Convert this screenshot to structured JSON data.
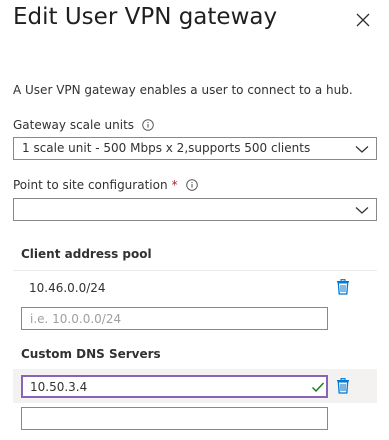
{
  "panel": {
    "title": "Edit User VPN gateway",
    "description": "A User VPN gateway enables a user to connect to a hub."
  },
  "gateway_scale_units": {
    "label": "Gateway scale units",
    "selected": "1 scale unit - 500 Mbps x 2,supports 500 clients"
  },
  "point_to_site": {
    "label": "Point to site configuration",
    "required_marker": "*",
    "selected": ""
  },
  "client_address_pool": {
    "heading": "Client address pool",
    "entries": [
      "10.46.0.0/24"
    ],
    "new_entry_placeholder": "i.e. 10.0.0.0/24"
  },
  "custom_dns_servers": {
    "heading": "Custom DNS Servers",
    "entries": [
      "10.50.3.4"
    ],
    "new_entry_value": ""
  },
  "colors": {
    "accent": "#0078d4",
    "focus_border": "#8764b8",
    "valid_check": "#107c10",
    "required": "#a4262c"
  },
  "icons": {
    "close": "close-icon",
    "info": "info-icon",
    "chevron": "chevron-down-icon",
    "delete": "trash-icon",
    "valid": "checkmark-icon"
  }
}
